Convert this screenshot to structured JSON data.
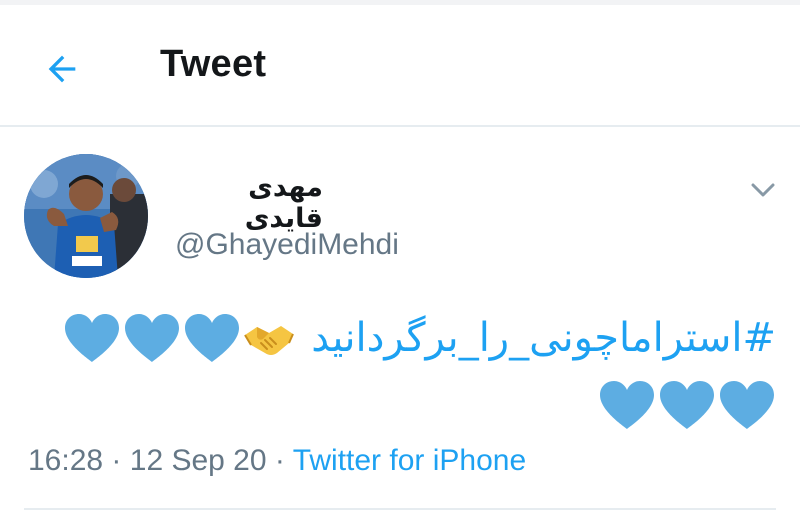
{
  "header": {
    "title": "Tweet",
    "back_icon": "arrow-left-icon",
    "accent": "#1da1f2"
  },
  "tweet": {
    "author": {
      "display_name": "مهدی قایدی",
      "handle": "@GhayediMehdi"
    },
    "menu_icon": "chevron-down-icon",
    "text": {
      "hashtag": "#استراماچونی_را_برگردانید",
      "line1_emojis": [
        "handshake-emoji",
        "blue-heart-emoji",
        "blue-heart-emoji",
        "blue-heart-emoji"
      ],
      "line2_emojis": [
        "blue-heart-emoji",
        "blue-heart-emoji",
        "blue-heart-emoji"
      ]
    },
    "meta": {
      "time": "16:28",
      "separator": "·",
      "date": "12 Sep 20",
      "source": "Twitter for iPhone"
    }
  },
  "colors": {
    "link": "#1da1f2",
    "secondary_text": "#657786",
    "divider": "#e6ecf0",
    "heart": "#5dade2"
  }
}
